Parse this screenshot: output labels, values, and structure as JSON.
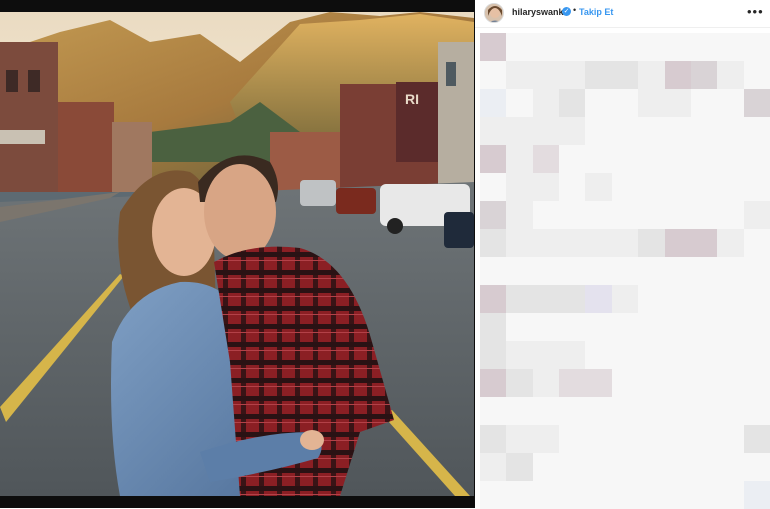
{
  "post": {
    "username": "hilaryswank",
    "follow_label": "Takip Et",
    "separator": "•",
    "more_label": "•••",
    "verified_glyph": "✓",
    "photo_description_icon": "photo"
  },
  "colors": {
    "accent": "#3897f0",
    "frame": "#0d0d0d",
    "pixel_palette": [
      "#ffffff",
      "#f7f7f7",
      "#eeeeee",
      "#e4e4e4",
      "#d9d3d6",
      "#e3dcdf",
      "#d7cbd0",
      "#e4e2ee",
      "#ebeef3",
      "#dcdadf"
    ]
  },
  "comment_pixelation": [
    [
      6,
      1,
      1,
      1,
      1,
      1,
      1,
      1,
      1,
      1,
      1
    ],
    [
      1,
      2,
      2,
      2,
      3,
      3,
      2,
      6,
      4,
      2,
      1
    ],
    [
      8,
      1,
      2,
      3,
      1,
      1,
      2,
      2,
      1,
      1,
      4
    ],
    [
      2,
      2,
      2,
      2,
      1,
      1,
      1,
      1,
      1,
      1,
      1
    ],
    [
      6,
      2,
      5,
      1,
      1,
      1,
      1,
      1,
      1,
      1,
      1
    ],
    [
      1,
      2,
      2,
      1,
      2,
      1,
      1,
      1,
      1,
      1,
      1
    ],
    [
      4,
      2,
      1,
      1,
      1,
      1,
      1,
      1,
      1,
      1,
      2
    ],
    [
      3,
      2,
      2,
      2,
      2,
      2,
      3,
      6,
      6,
      2,
      1
    ],
    [
      1,
      1,
      1,
      1,
      1,
      1,
      1,
      1,
      1,
      1,
      1
    ],
    [
      6,
      3,
      3,
      3,
      7,
      2,
      1,
      1,
      1,
      1,
      1
    ],
    [
      3,
      1,
      1,
      1,
      1,
      1,
      1,
      1,
      1,
      1,
      1
    ],
    [
      3,
      2,
      2,
      2,
      1,
      1,
      1,
      1,
      1,
      1,
      1
    ],
    [
      6,
      3,
      2,
      5,
      5,
      1,
      1,
      1,
      1,
      1,
      1
    ],
    [
      1,
      1,
      1,
      1,
      1,
      1,
      1,
      1,
      1,
      1,
      1
    ],
    [
      3,
      2,
      2,
      1,
      1,
      1,
      1,
      1,
      1,
      1,
      3
    ],
    [
      2,
      3,
      1,
      1,
      1,
      1,
      1,
      1,
      1,
      1,
      1
    ],
    [
      1,
      1,
      1,
      1,
      1,
      1,
      1,
      1,
      1,
      1,
      8
    ]
  ]
}
